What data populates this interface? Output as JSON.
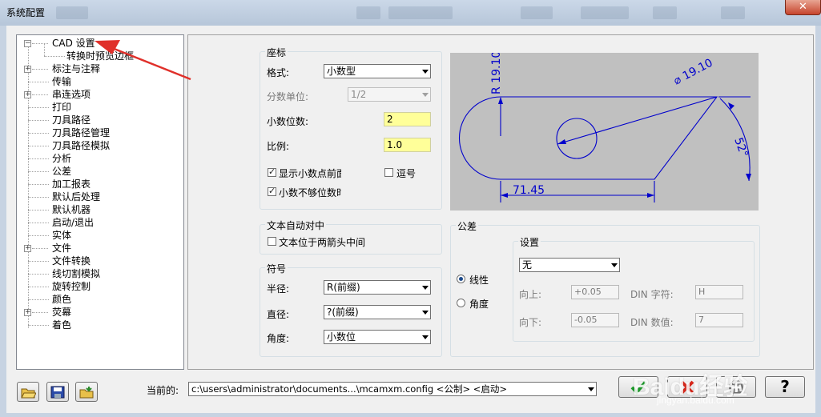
{
  "window": {
    "title": "系统配置",
    "close_glyph": "✕"
  },
  "tree": {
    "items": [
      {
        "label": "CAD 设置",
        "expander": "−"
      },
      {
        "label": "转换时预览边框",
        "expander": ""
      },
      {
        "label": "标注与注释",
        "expander": "+"
      },
      {
        "label": "传输",
        "expander": ""
      },
      {
        "label": "串连选项",
        "expander": "+"
      },
      {
        "label": "打印",
        "expander": ""
      },
      {
        "label": "刀具路径",
        "expander": ""
      },
      {
        "label": "刀具路径管理",
        "expander": ""
      },
      {
        "label": "刀具路径模拟",
        "expander": ""
      },
      {
        "label": "分析",
        "expander": ""
      },
      {
        "label": "公差",
        "expander": ""
      },
      {
        "label": "加工报表",
        "expander": ""
      },
      {
        "label": "默认后处理",
        "expander": ""
      },
      {
        "label": "默认机器",
        "expander": ""
      },
      {
        "label": "启动/退出",
        "expander": ""
      },
      {
        "label": "实体",
        "expander": ""
      },
      {
        "label": "文件",
        "expander": "+"
      },
      {
        "label": "文件转换",
        "expander": ""
      },
      {
        "label": "线切割模拟",
        "expander": ""
      },
      {
        "label": "旋转控制",
        "expander": ""
      },
      {
        "label": "颜色",
        "expander": ""
      },
      {
        "label": "荧幕",
        "expander": "+"
      },
      {
        "label": "着色",
        "expander": ""
      }
    ]
  },
  "coords": {
    "group_title": "座标",
    "format_label": "格式:",
    "format_value": "小数型",
    "frac_label": "分数单位:",
    "frac_value": "1/2",
    "decimals_label": "小数位数:",
    "decimals_value": "2",
    "scale_label": "比例:",
    "scale_value": "1.0",
    "show_leading_label": "显示小数点前面",
    "comma_label": "逗号",
    "pad_label": "小数不够位数时"
  },
  "text_center": {
    "group_title": "文本自动对中",
    "between_arrows_label": "文本位于两箭头中间"
  },
  "symbols": {
    "group_title": "符号",
    "radius_label": "半径:",
    "radius_value": "R(前缀)",
    "diameter_label": "直径:",
    "diameter_value": "?(前缀)",
    "angle_label": "角度:",
    "angle_value": "小数位"
  },
  "preview": {
    "radius_text": "R 19.10",
    "diameter_text": "⌀ 19.10",
    "angle_text": "52°",
    "length_text": "71.45"
  },
  "tolerance": {
    "group_title": "公差",
    "linear_label": "线性",
    "angular_label": "角度",
    "settings_title": "设置",
    "type_value": "无",
    "upper_label": "向上:",
    "upper_value": "+0.05",
    "lower_label": "向下:",
    "lower_value": "-0.05",
    "din_char_label": "DIN 字符:",
    "din_char_value": "H",
    "din_value_label": "DIN 数值:",
    "din_value_value": "7"
  },
  "footer": {
    "current_label": "当前的:",
    "current_path": "c:\\users\\administrator\\documents...\\mcamxm.config <公制> <启动>",
    "help_glyph": "?"
  },
  "watermark": {
    "text": "Baidu经验",
    "url": "jingyan.baidu.com"
  },
  "colors": {
    "annotation_red": "#e0302a",
    "highlight_yellow": "#ffff99",
    "preview_bg": "#c0c0c0",
    "preview_line": "#0000cc"
  }
}
